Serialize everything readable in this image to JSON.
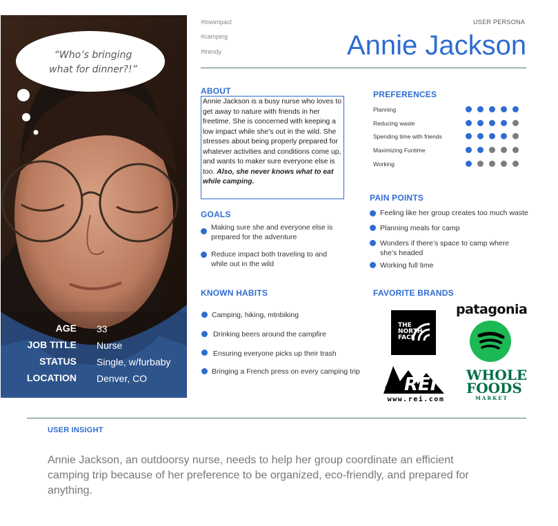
{
  "header": {
    "tags": [
      "#lowimpact",
      "#camping",
      "#trendy"
    ],
    "persona_label": "USER PERSONA",
    "name": "Annie Jackson"
  },
  "photo": {
    "quote": "“Who’s bringing what for dinner?!”",
    "stats": [
      {
        "label": "AGE",
        "value": "33"
      },
      {
        "label": "JOB TITLE",
        "value": "Nurse"
      },
      {
        "label": "STATUS",
        "value": "Single, w/furbaby"
      },
      {
        "label": "LOCATION",
        "value": "Denver, CO"
      }
    ]
  },
  "about": {
    "title": "ABOUT",
    "text": "Annie Jackson is a busy nurse who loves to get away to nature with friends in her freetime. She is concerned with keeping a low impact while she’s out in the wild. She stresses about being properly prepared for whatever activities and conditions come up, and wants to maker sure everyone else is too.",
    "emphasis": "Also, she never knows what to eat while camping."
  },
  "goals": {
    "title": "GOALS",
    "items": [
      "Making sure she and everyone else is prepared for the adventure",
      "Reduce impact both traveling to and while out in the wild"
    ]
  },
  "habits": {
    "title": "KNOWN HABITS",
    "items": [
      "Camping, hiking, mtnbiking",
      "Drinking beers around the campfire",
      "Ensuring everyone picks up their trash",
      "Bringing a French press on every camping trip"
    ]
  },
  "preferences": {
    "title": "PREFERENCES",
    "active_color": "#2f6cd1",
    "inactive_color": "#7d7d7d",
    "items": [
      {
        "label": "Planning",
        "level": 5
      },
      {
        "label": "Reducing waste",
        "level": 4
      },
      {
        "label": "Spending time with friends",
        "level": 4
      },
      {
        "label": "Maximizing Funtime",
        "level": 2
      },
      {
        "label": "Working",
        "level": 1
      }
    ],
    "max": 5
  },
  "pain_points": {
    "title": "PAIN POINTS",
    "items": [
      "Feeling like her group creates too much waste",
      "Planning meals for camp",
      "Wonders if there’s space to camp where she’s headed",
      "Working full time"
    ]
  },
  "brands": {
    "title": "FAVORITE BRANDS",
    "north_face": [
      "THE",
      "NORTH",
      "FACE"
    ],
    "patagonia": "patagonia",
    "rei": "REI",
    "rei_url": "www.rei.com",
    "whole_foods": [
      "WHOLE",
      "FOODS",
      "MARKET"
    ]
  },
  "insight": {
    "title": "USER INSIGHT",
    "text": "Annie Jackson, an outdoorsy nurse, needs to help her group coordinate an efficient camping trip because of her preference to be organized, eco-friendly, and prepared for anything."
  }
}
